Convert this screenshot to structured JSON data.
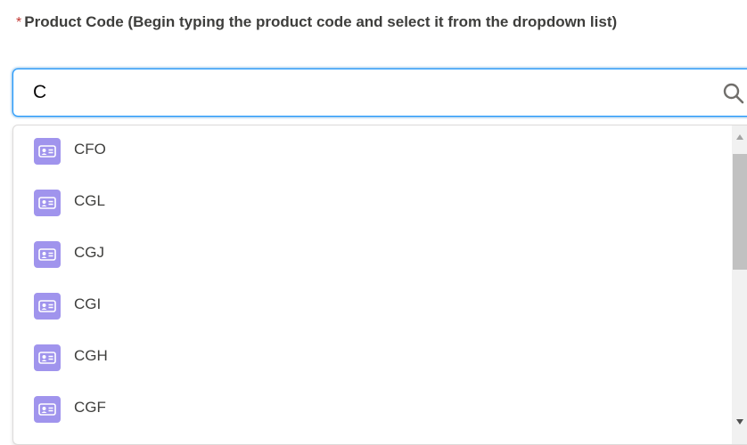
{
  "field": {
    "required_marker": "*",
    "label": "Product Code (Begin typing the product code and select it from the dropdown list)",
    "value": "C",
    "search_icon": "search-icon"
  },
  "dropdown": {
    "option_icon": "contact-card-icon",
    "option_icon_color": "#a094ed",
    "options": [
      {
        "label": "CFO"
      },
      {
        "label": "CGL"
      },
      {
        "label": "CGJ"
      },
      {
        "label": "CGI"
      },
      {
        "label": "CGH"
      },
      {
        "label": "CGF"
      }
    ]
  },
  "colors": {
    "focus_border": "#1b96ff",
    "required": "#c23934"
  }
}
